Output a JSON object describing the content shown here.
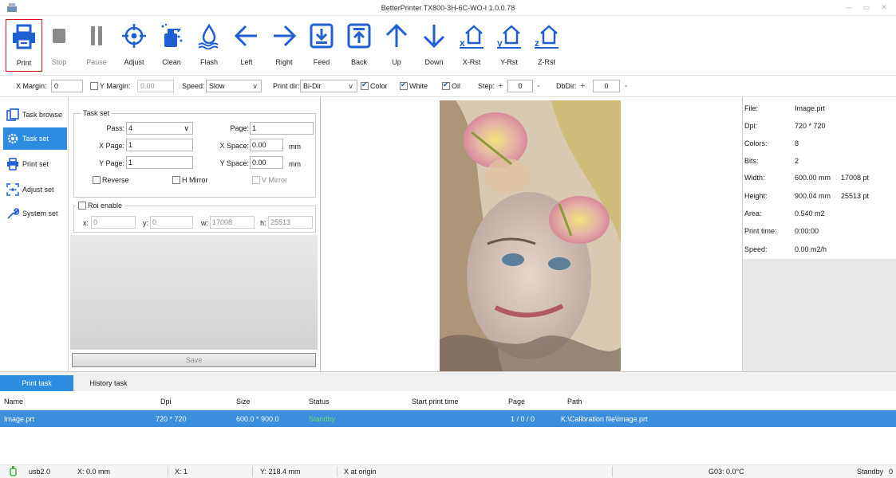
{
  "window": {
    "title": "BetterPrinter TX800-3H-6C-WO-I 1.0.0.78"
  },
  "toolbar": {
    "items": [
      {
        "label": "Print"
      },
      {
        "label": "Stop"
      },
      {
        "label": "Pause"
      },
      {
        "label": "Adjust"
      },
      {
        "label": "Clean"
      },
      {
        "label": "Flash"
      },
      {
        "label": "Left"
      },
      {
        "label": "Right"
      },
      {
        "label": "Feed"
      },
      {
        "label": "Back"
      },
      {
        "label": "Up"
      },
      {
        "label": "Down"
      },
      {
        "label": "X-Rst"
      },
      {
        "label": "Y-Rst"
      },
      {
        "label": "Z-Rst"
      }
    ],
    "accent": "#1f5fd1"
  },
  "options": {
    "x_margin_label": "X Margin:",
    "x_margin_value": "0",
    "y_margin_label": "Y Margin:",
    "y_margin_value": "0.00",
    "speed_label": "Speed:",
    "speed_value": "Slow",
    "print_dir_label": "Print dir:",
    "print_dir_value": "Bi-Dir",
    "color_label": "Color",
    "white_label": "White",
    "oil_label": "Oil",
    "step_label": "Step:",
    "step_plus": "+",
    "step_value": "0",
    "step_minus": "-",
    "dbdir_label": "DbDir:",
    "dbdir_plus": "+",
    "dbdir_value": "0",
    "dbdir_minus": "-"
  },
  "nav": {
    "items": [
      {
        "label": "Task browse"
      },
      {
        "label": "Task set"
      },
      {
        "label": "Print set"
      },
      {
        "label": "Adjust set"
      },
      {
        "label": "System set"
      }
    ],
    "active_color": "#2e8ce0"
  },
  "taskset": {
    "group_title": "Task set",
    "pass_label": "Pass:",
    "pass_value": "4",
    "page_label": "Page:",
    "page_value": "1",
    "xpage_label": "X Page:",
    "xpage_value": "1",
    "xspace_label": "X Space:",
    "xspace_value": "0.00",
    "xspace_unit": "mm",
    "ypage_label": "Y Page:",
    "ypage_value": "1",
    "yspace_label": "Y Space:",
    "yspace_value": "0.00",
    "yspace_unit": "mm",
    "reverse_label": "Reverse",
    "hmirror_label": "H Mirror",
    "vmirror_label": "V Mirror",
    "roi_label": "Roi enable",
    "roi_x_label": "x:",
    "roi_x_value": "0",
    "roi_y_label": "y:",
    "roi_y_value": "0",
    "roi_w_label": "w:",
    "roi_w_value": "17008",
    "roi_h_label": "h:",
    "roi_h_value": "25513",
    "save_label": "Save"
  },
  "info": {
    "rows": [
      {
        "k": "File:",
        "v": "Image.prt",
        "v2": ""
      },
      {
        "k": "Dpi:",
        "v": "720 * 720",
        "v2": ""
      },
      {
        "k": "Colors:",
        "v": "8",
        "v2": ""
      },
      {
        "k": "Bits:",
        "v": "2",
        "v2": ""
      },
      {
        "k": "Width:",
        "v": "600.00 mm",
        "v2": "17008 pt"
      },
      {
        "k": "Height:",
        "v": "900.04 mm",
        "v2": "25513 pt"
      },
      {
        "k": "Area:",
        "v": "0.540 m2",
        "v2": ""
      },
      {
        "k": "Print time:",
        "v": "0:00:00",
        "v2": ""
      },
      {
        "k": "Speed:",
        "v": "0.00 m2/h",
        "v2": ""
      }
    ]
  },
  "tasks": {
    "tabs": [
      {
        "label": "Print task"
      },
      {
        "label": "History task"
      }
    ],
    "columns": {
      "name": "Name",
      "dpi": "Dpi",
      "size": "Size",
      "status": "Status",
      "start": "Start print time",
      "page": "Page",
      "path": "Path"
    },
    "rows": [
      {
        "name": "Image.prt",
        "dpi": "720 * 720",
        "size": "600.0 * 900.0",
        "status": "Standby",
        "start": "",
        "page": "1 / 0 / 0",
        "path": "K:\\Calibration file\\Image.prt"
      }
    ],
    "row_color": "#3a8edc"
  },
  "statusbar": {
    "usb": "usb2.0",
    "x_mm": "X: 0.0 mm",
    "x_count": "X: 1",
    "y_mm": "Y: 218.4 mm",
    "origin": "X at origin",
    "temp": "G03: 0.0°C",
    "state": "Standby",
    "state_num": "0"
  }
}
